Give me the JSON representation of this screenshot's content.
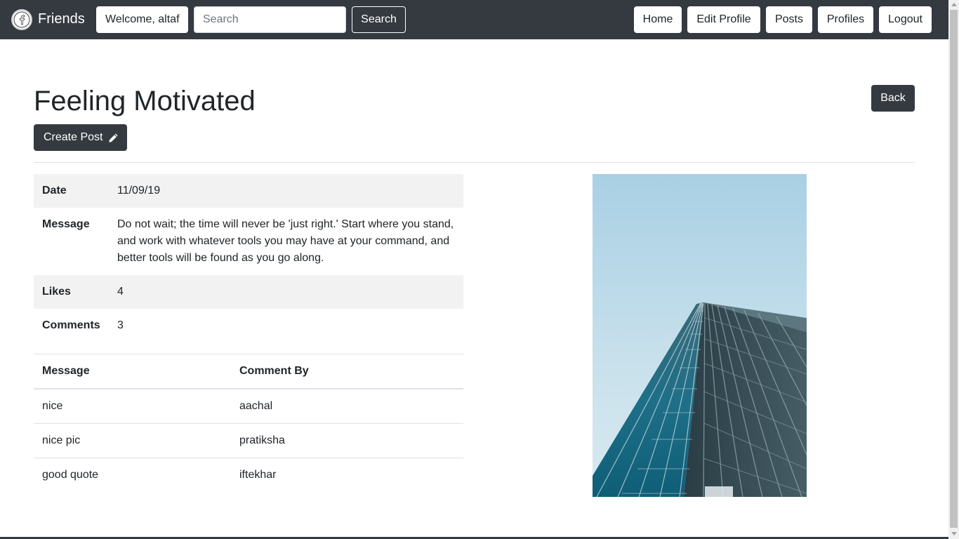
{
  "navbar": {
    "brand": "Friends",
    "welcome": "Welcome, altaf",
    "search_placeholder": "Search",
    "search_button": "Search",
    "links": [
      "Home",
      "Edit Profile",
      "Posts",
      "Profiles",
      "Logout"
    ]
  },
  "page": {
    "title": "Feeling Motivated",
    "back_button": "Back",
    "create_post_button": "Create Post"
  },
  "details": [
    {
      "label": "Date",
      "value": "11/09/19"
    },
    {
      "label": "Message",
      "value": "Do not wait; the time will never be 'just right.' Start where you stand, and work with whatever tools you may have at your command, and better tools will be found as you go along."
    },
    {
      "label": "Likes",
      "value": "4"
    },
    {
      "label": "Comments",
      "value": "3"
    }
  ],
  "comments": {
    "headers": [
      "Message",
      "Comment By"
    ],
    "rows": [
      {
        "message": "nice",
        "by": "aachal"
      },
      {
        "message": "nice pic",
        "by": "pratiksha"
      },
      {
        "message": "good quote",
        "by": "iftekhar"
      }
    ]
  },
  "colors": {
    "navbar": "#343a40",
    "button_dark": "#343a40",
    "stripe": "#f2f2f2"
  },
  "icons": [
    "facebook-logo-icon",
    "pencil-icon"
  ]
}
